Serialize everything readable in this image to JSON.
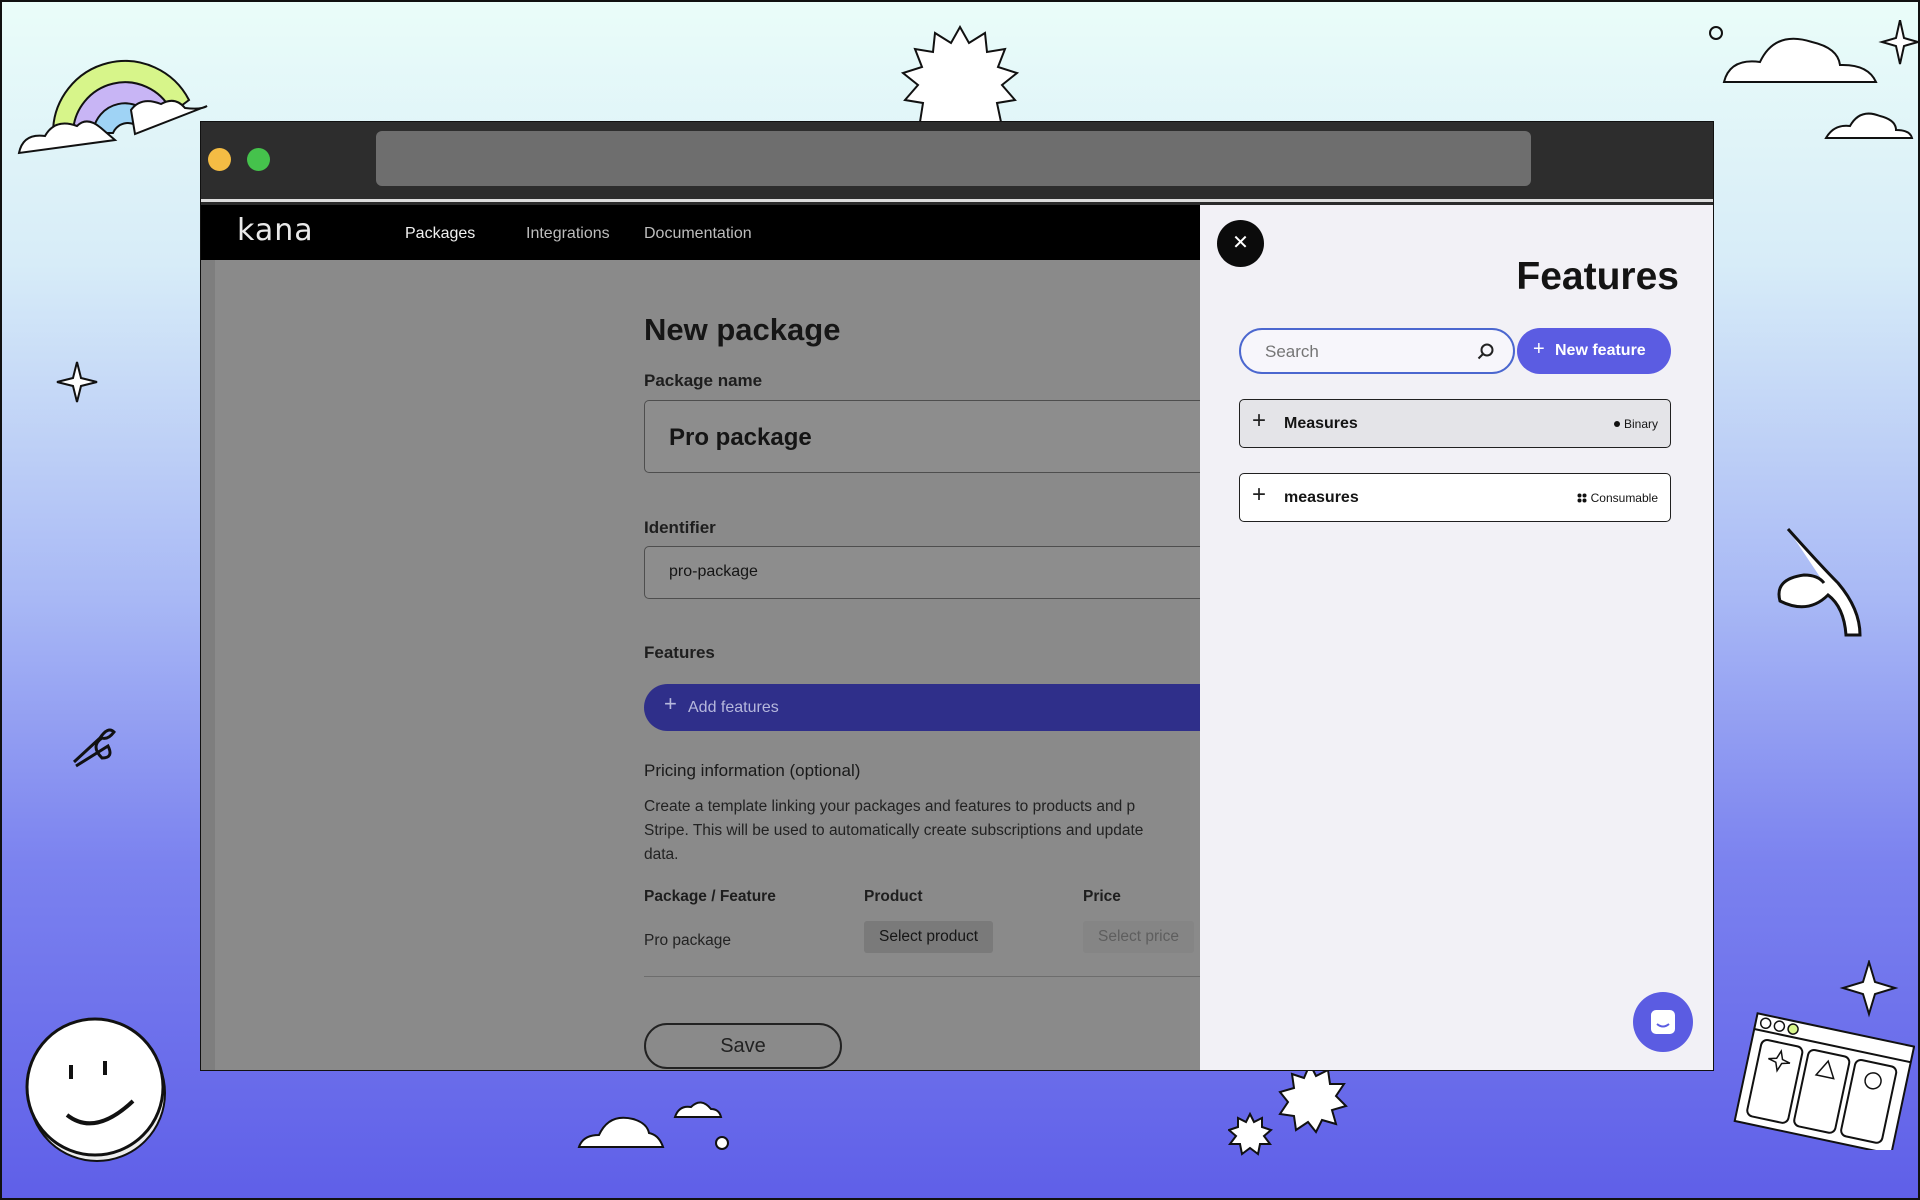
{
  "nav": {
    "logo": "kana",
    "links": [
      "Packages",
      "Integrations",
      "Documentation"
    ]
  },
  "form": {
    "title": "New package",
    "package_name_label": "Package name",
    "package_name_value": "Pro package",
    "identifier_label": "Identifier",
    "identifier_value": "pro-package",
    "features_label": "Features",
    "add_features_label": "Add features",
    "pricing_title": "Pricing information (optional)",
    "pricing_desc": [
      "Create a template linking your packages and features to products and p",
      "Stripe. This will be used to automatically create subscriptions and update",
      "data."
    ],
    "table_headers": [
      "Package / Feature",
      "Product",
      "Price"
    ],
    "table_row": {
      "name": "Pro package",
      "product": "Select product",
      "price": "Select price"
    },
    "save_label": "Save"
  },
  "drawer": {
    "title": "Features",
    "search_placeholder": "Search",
    "new_feature_label": "New feature",
    "items": [
      {
        "name": "Measures",
        "type": "Binary"
      },
      {
        "name": "measures",
        "type": "Consumable"
      }
    ]
  },
  "colors": {
    "accent": "#5b5ce2",
    "overlay_button": "#2f2f8a"
  }
}
